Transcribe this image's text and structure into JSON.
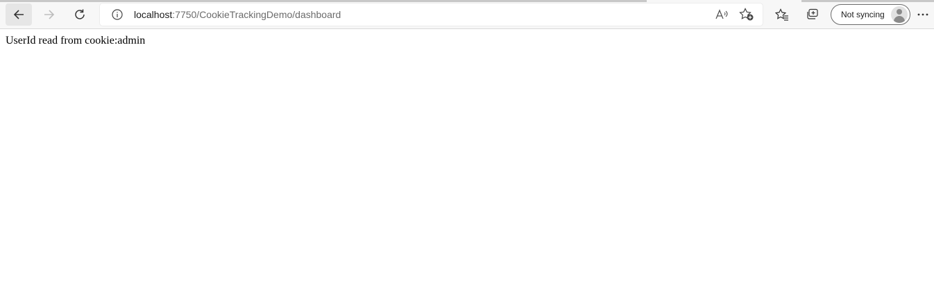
{
  "browser": {
    "url_host": "localhost",
    "url_path": ":7750/CookieTrackingDemo/dashboard",
    "profile_label": "Not syncing"
  },
  "page": {
    "message": "UserId read from cookie:admin"
  },
  "icons": {
    "back": "arrow-left-icon",
    "forward": "arrow-right-icon",
    "refresh": "refresh-icon",
    "site_info": "info-icon",
    "read_aloud": "read-aloud-icon",
    "add_favorite": "star-plus-icon",
    "favorites": "favorites-icon",
    "collections": "collections-icon",
    "profile": "avatar-icon",
    "more": "more-icon"
  },
  "colors": {
    "chrome_bg": "#f7f7f7",
    "url_path": "#6b6b6b",
    "text": "#000000"
  }
}
